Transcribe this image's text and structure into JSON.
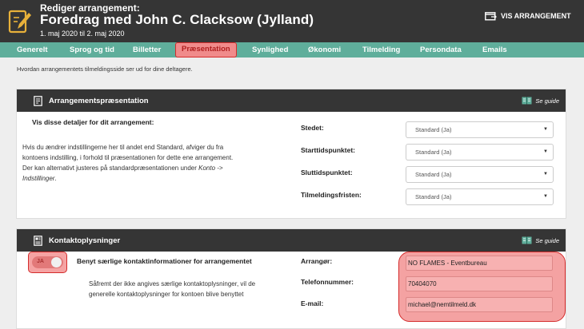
{
  "header": {
    "subtitle": "Rediger arrangement:",
    "title": "Foredrag med John C. Clacksow (Jylland)",
    "dates": "1. maj 2020 til 2. maj 2020",
    "view_button": "VIS ARRANGEMENT"
  },
  "tabs": [
    {
      "label": "Generelt"
    },
    {
      "label": "Sprog og tid"
    },
    {
      "label": "Billetter"
    },
    {
      "label": "Præsentation",
      "active": true
    },
    {
      "label": "Synlighed"
    },
    {
      "label": "Økonomi"
    },
    {
      "label": "Tilmelding"
    },
    {
      "label": "Persondata"
    },
    {
      "label": "Emails"
    }
  ],
  "intro": "Hvordan arrangementets tilmeldingsside ser ud for dine deltagere.",
  "presentation_panel": {
    "title": "Arrangementspræsentation",
    "guide": "Se guide",
    "lead": "Vis disse detaljer for dit arrangement:",
    "para_line1": "Hvis du ændrer indstillingerne her til andet end Standard, afviger du fra",
    "para_line2": "kontoens indstilling, i forhold til præsentationen for dette ene arrangement.",
    "para_line3": "Der kan alternativt justeres på standardpræsentationen under ",
    "para_link": "Konto ->",
    "para_link2": "Indstillinger",
    "para_end": ".",
    "fields": [
      {
        "label": "Stedet:",
        "value": "Standard (Ja)"
      },
      {
        "label": "Starttidspunktet:",
        "value": "Standard (Ja)"
      },
      {
        "label": "Sluttidspunktet:",
        "value": "Standard (Ja)"
      },
      {
        "label": "Tilmeldingsfristen:",
        "value": "Standard (Ja)"
      }
    ]
  },
  "contact_panel": {
    "title": "Kontaktoplysninger",
    "guide": "Se guide",
    "toggle_label": "JA",
    "lead": "Benyt særlige kontaktinformationer for arrangementet",
    "para_line1": "Såfremt der ikke angives særlige kontaktoplysninger, vil de",
    "para_line2": "generelle kontaktoplysninger for kontoen blive benyttet",
    "fields": [
      {
        "label": "Arrangør:",
        "value": "NO FLAMES - Eventbureau"
      },
      {
        "label": "Telefonnummer:",
        "value": "70404070"
      },
      {
        "label": "E-mail:",
        "value": "michael@nemtilmeld.dk"
      }
    ]
  },
  "colors": {
    "header_bg": "#353535",
    "tab_bar": "#5fae9b",
    "highlight": "#f4a2a2",
    "highlight_border": "#d42c2c"
  }
}
